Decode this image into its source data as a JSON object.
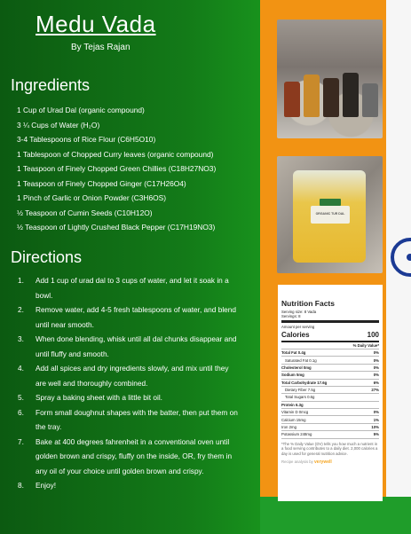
{
  "title": "Medu Vada",
  "author": "By Tejas Rajan",
  "ingredients_heading": "Ingredients",
  "ingredients": [
    "1 Cup of Urad Dal (organic compound)",
    "3 ¼ Cups of Water (H₂O)",
    "3-4 Tablespoons of Rice Flour (C6H5O10)",
    "1 Tablespoon of Chopped Curry leaves (organic compound)",
    "1 Teaspoon of Finely Chopped Green Chillies (C18H27NO3)",
    "1 Teaspoon of Finely Chopped Ginger (C17H26O4)",
    "1 Pinch of Garlic or Onion Powder (C3H6OS)",
    "½ Teaspoon of Cumin Seeds (C10H12O)",
    "½ Teaspoon of Lightly Crushed Black Pepper (C17H19NO3)"
  ],
  "directions_heading": "Directions",
  "directions": [
    {
      "num": "1.",
      "text": "Add 1 cup of urad dal to 3 cups of water, and let it soak in a bowl."
    },
    {
      "num": "2.",
      "text": "Remove water, add 4-5 fresh tablespoons of water, and blend until near smooth."
    },
    {
      "num": "3.",
      "text": "When done blending, whisk until all dal chunks disappear and until fluffy and smooth."
    },
    {
      "num": "4.",
      "text": "Add all spices and dry ingredients slowly, and mix until they are well and thoroughly combined."
    },
    {
      "num": "5.",
      "text": "Spray a baking sheet with a little bit oil."
    },
    {
      "num": "6.",
      "text": "Form small doughnut shapes with the batter, then put them on the tray."
    },
    {
      "num": "7.",
      "text": "Bake at 400 degrees fahrenheit in a conventional oven until golden brown and crispy, fluffy on the inside, OR, fry them in any oil of your choice until golden brown and crispy."
    },
    {
      "num": "8.",
      "text": "Enjoy!"
    }
  ],
  "bag_label": "ORGANIC TUR DAL",
  "nutrition": {
    "title": "Nutrition Facts",
    "serving_size": "Serving size: 8 Vada",
    "servings": "Servings: 8",
    "amount_per": "Amount per serving",
    "calories_label": "Calories",
    "calories_value": "100",
    "dv_header": "% Daily Value*",
    "rows": [
      {
        "label": "Total Fat 0.4g",
        "dv": "0%",
        "bold": true,
        "indent": false
      },
      {
        "label": "Saturated Fat 0.1g",
        "dv": "0%",
        "bold": false,
        "indent": true
      },
      {
        "label": "Cholesterol 0mg",
        "dv": "0%",
        "bold": true,
        "indent": false
      },
      {
        "label": "Sodium 5mg",
        "dv": "0%",
        "bold": true,
        "indent": false
      },
      {
        "label": "Total Carbohydrate 17.6g",
        "dv": "6%",
        "bold": true,
        "indent": false
      },
      {
        "label": "Dietary Fiber 7.5g",
        "dv": "27%",
        "bold": false,
        "indent": true
      },
      {
        "label": "Total Sugars 0.6g",
        "dv": "",
        "bold": false,
        "indent": true
      },
      {
        "label": "Protein 6.3g",
        "dv": "",
        "bold": true,
        "indent": false
      },
      {
        "label": "Vitamin D 0mcg",
        "dv": "0%",
        "bold": false,
        "indent": false
      },
      {
        "label": "Calcium 15mg",
        "dv": "1%",
        "bold": false,
        "indent": false
      },
      {
        "label": "Iron 2mg",
        "dv": "10%",
        "bold": false,
        "indent": false
      },
      {
        "label": "Potassium 248mg",
        "dv": "5%",
        "bold": false,
        "indent": false
      }
    ],
    "footnote": "*The % Daily Value (DV) tells you how much a nutrient in a food serving contributes to a daily diet. 2,000 calories a day is used for general nutrition advice.",
    "powered_by": "Recipe analysis by",
    "brand": "verywell"
  },
  "colors": {
    "orange": "#f29313",
    "green": "#137a18",
    "white": "#f6f6f6",
    "chakra": "#1b3a94"
  }
}
